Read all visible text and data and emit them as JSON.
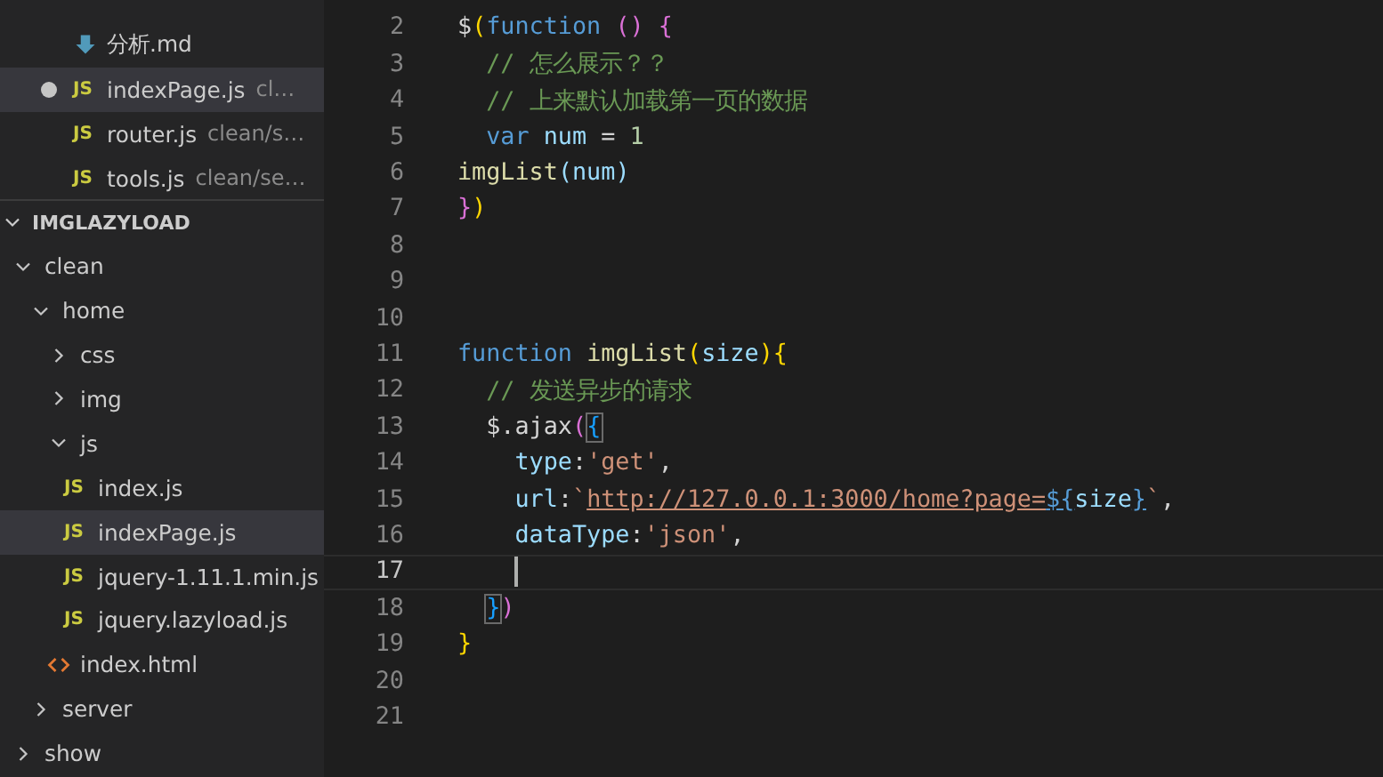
{
  "open_editors": [
    {
      "name": "分析.md",
      "kind": "md",
      "modified": false,
      "selected": false
    },
    {
      "name": "indexPage.js",
      "path": "cl…",
      "kind": "js",
      "icon": "JS",
      "modified": true,
      "selected": true
    },
    {
      "name": "router.js",
      "path": "clean/s…",
      "kind": "js",
      "icon": "JS",
      "modified": false,
      "selected": false
    },
    {
      "name": "tools.js",
      "path": "clean/se…",
      "kind": "js",
      "icon": "JS",
      "modified": false,
      "selected": false
    }
  ],
  "explorer": {
    "title": "IMGLAZYLOAD",
    "expanded": true,
    "tree": [
      {
        "name": "clean",
        "kind": "folder",
        "expanded": true,
        "selected": false,
        "children": [
          {
            "name": "home",
            "kind": "folder",
            "expanded": true,
            "selected": false,
            "children": [
              {
                "name": "css",
                "kind": "folder",
                "expanded": false,
                "selected": false
              },
              {
                "name": "img",
                "kind": "folder",
                "expanded": false,
                "selected": false
              },
              {
                "name": "js",
                "kind": "folder",
                "expanded": true,
                "selected": false,
                "children": [
                  {
                    "name": "index.js",
                    "kind": "js",
                    "icon": "JS",
                    "selected": false
                  },
                  {
                    "name": "indexPage.js",
                    "kind": "js",
                    "icon": "JS",
                    "selected": true
                  },
                  {
                    "name": "jquery-1.11.1.min.js",
                    "kind": "js",
                    "icon": "JS",
                    "selected": false
                  },
                  {
                    "name": "jquery.lazyload.js",
                    "kind": "js",
                    "icon": "JS",
                    "selected": false
                  }
                ]
              },
              {
                "name": "index.html",
                "kind": "html",
                "selected": false
              }
            ]
          },
          {
            "name": "server",
            "kind": "folder",
            "expanded": false,
            "selected": false
          }
        ]
      },
      {
        "name": "show",
        "kind": "folder",
        "expanded": false,
        "selected": false
      }
    ]
  },
  "editor": {
    "lines": [
      {
        "number": "2",
        "current": false,
        "tokens": [
          {
            "text": "$",
            "kind": "plain"
          },
          {
            "text": "(",
            "kind": "b1"
          },
          {
            "text": "function",
            "kind": "keyword"
          },
          {
            "text": " ()",
            "kind": "b2"
          },
          {
            "text": " {",
            "kind": "b2"
          }
        ]
      },
      {
        "number": "3",
        "current": false,
        "tokens": [
          {
            "text": "  // 怎么展示？？",
            "kind": "comment"
          }
        ]
      },
      {
        "number": "4",
        "current": false,
        "tokens": [
          {
            "text": "  // 上来默认加载第一页的数据",
            "kind": "comment"
          }
        ]
      },
      {
        "number": "5",
        "current": false,
        "tokens": [
          {
            "text": "  var",
            "kind": "keyword"
          },
          {
            "text": " num",
            "kind": "var"
          },
          {
            "text": " = ",
            "kind": "plain"
          },
          {
            "text": "1",
            "kind": "number"
          }
        ]
      },
      {
        "number": "6",
        "current": false,
        "tokens": [
          {
            "text": "imgList",
            "kind": "func"
          },
          {
            "text": "(",
            "kind": "punct"
          },
          {
            "text": "num",
            "kind": "var"
          },
          {
            "text": ")",
            "kind": "punct"
          }
        ]
      },
      {
        "number": "7",
        "current": false,
        "tokens": [
          {
            "text": "}",
            "kind": "b2"
          },
          {
            "text": ")",
            "kind": "b1"
          }
        ]
      },
      {
        "number": "8",
        "current": false
      },
      {
        "number": "9",
        "current": false
      },
      {
        "number": "10",
        "current": false
      },
      {
        "number": "11",
        "current": false,
        "tokens": [
          {
            "text": "function",
            "kind": "keyword"
          },
          {
            "text": " imgList",
            "kind": "func"
          },
          {
            "text": "(",
            "kind": "b1"
          },
          {
            "text": "size",
            "kind": "var"
          },
          {
            "text": "){",
            "kind": "b1"
          }
        ]
      },
      {
        "number": "12",
        "current": false,
        "tokens": [
          {
            "text": "  // 发送异步的请求",
            "kind": "comment"
          }
        ]
      },
      {
        "number": "13",
        "current": false,
        "tokens": [
          {
            "text": "  $.ajax",
            "kind": "plain"
          },
          {
            "text": "(",
            "kind": "b2"
          },
          {
            "text": "{",
            "kind": "match"
          }
        ]
      },
      {
        "number": "14",
        "current": false,
        "tokens": [
          {
            "text": "    type",
            "kind": "var"
          },
          {
            "text": ":",
            "kind": "plain"
          },
          {
            "text": "'get'",
            "kind": "string"
          },
          {
            "text": ",",
            "kind": "plain"
          }
        ]
      },
      {
        "number": "15",
        "current": false,
        "tokens": [
          {
            "text": "    url",
            "kind": "var"
          },
          {
            "text": ":",
            "kind": "plain"
          },
          {
            "text": "`",
            "kind": "string"
          },
          {
            "text": "http://127.0.0.1:3000/home?page=",
            "kind": "link"
          },
          {
            "text": "${",
            "kind": "tpl"
          },
          {
            "text": "size",
            "kind": "var"
          },
          {
            "text": "}",
            "kind": "tpl"
          },
          {
            "text": "`",
            "kind": "string"
          },
          {
            "text": ",",
            "kind": "plain"
          }
        ]
      },
      {
        "number": "16",
        "current": false,
        "tokens": [
          {
            "text": "    dataType",
            "kind": "var"
          },
          {
            "text": ":",
            "kind": "plain"
          },
          {
            "text": "'json'",
            "kind": "string"
          },
          {
            "text": ",",
            "kind": "plain"
          }
        ]
      },
      {
        "number": "17",
        "current": true
      },
      {
        "number": "18",
        "current": false,
        "tokens": [
          {
            "text": "  }",
            "kind": "match"
          },
          {
            "text": ")",
            "kind": "b2"
          }
        ]
      },
      {
        "number": "19",
        "current": false,
        "tokens": [
          {
            "text": "}",
            "kind": "b1"
          }
        ]
      },
      {
        "number": "20",
        "current": false
      },
      {
        "number": "21",
        "current": false
      }
    ]
  }
}
